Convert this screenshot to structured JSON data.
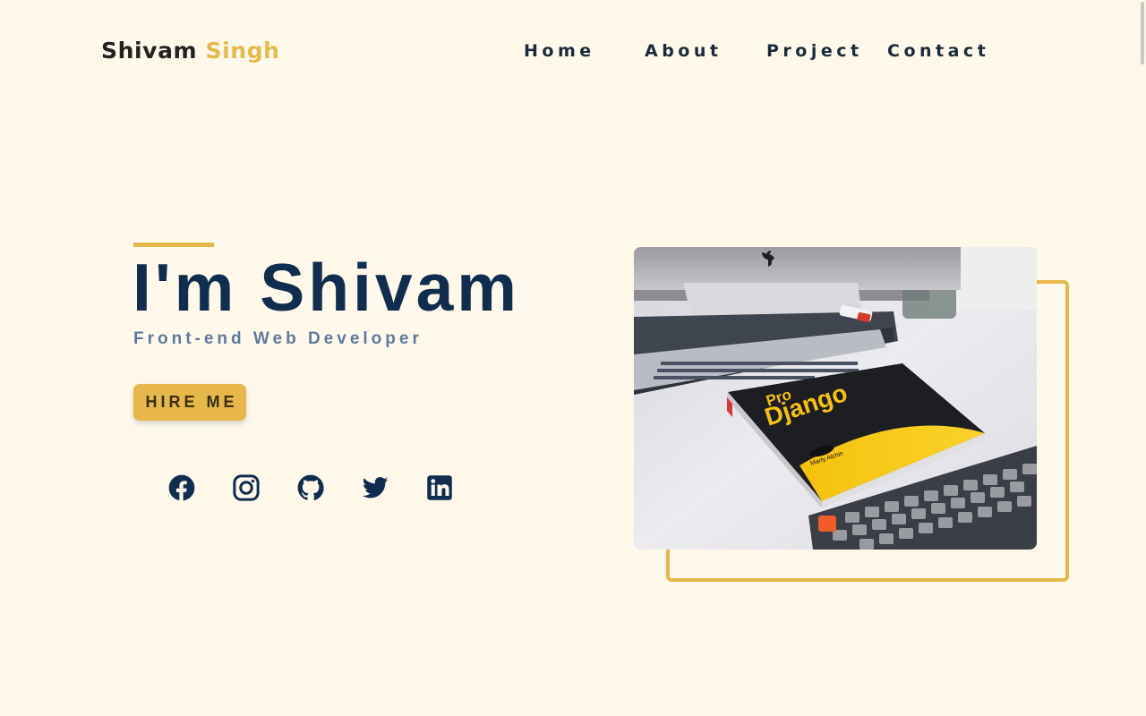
{
  "brand": {
    "first": "Shivam",
    "last": "Singh"
  },
  "nav": {
    "items": [
      {
        "label": "Home"
      },
      {
        "label": "About"
      },
      {
        "label": "Project"
      },
      {
        "label": "Contact"
      }
    ]
  },
  "hero": {
    "title": "I'm Shivam",
    "subtitle": "Front-end Web Developer",
    "cta_label": "HIRE ME"
  },
  "social": [
    {
      "icon": "facebook-icon"
    },
    {
      "icon": "instagram-icon"
    },
    {
      "icon": "github-icon"
    },
    {
      "icon": "twitter-icon"
    },
    {
      "icon": "linkedin-icon"
    }
  ],
  "photo": {
    "book_title_line1": "Pro",
    "book_title_line2": "Django",
    "book_author": "Marty Alchin"
  },
  "colors": {
    "background": "#fdf8ea",
    "accent": "#e6b84a",
    "heading": "#112d4e",
    "subtitle": "#5f7a9c",
    "icon": "#112d4e"
  }
}
